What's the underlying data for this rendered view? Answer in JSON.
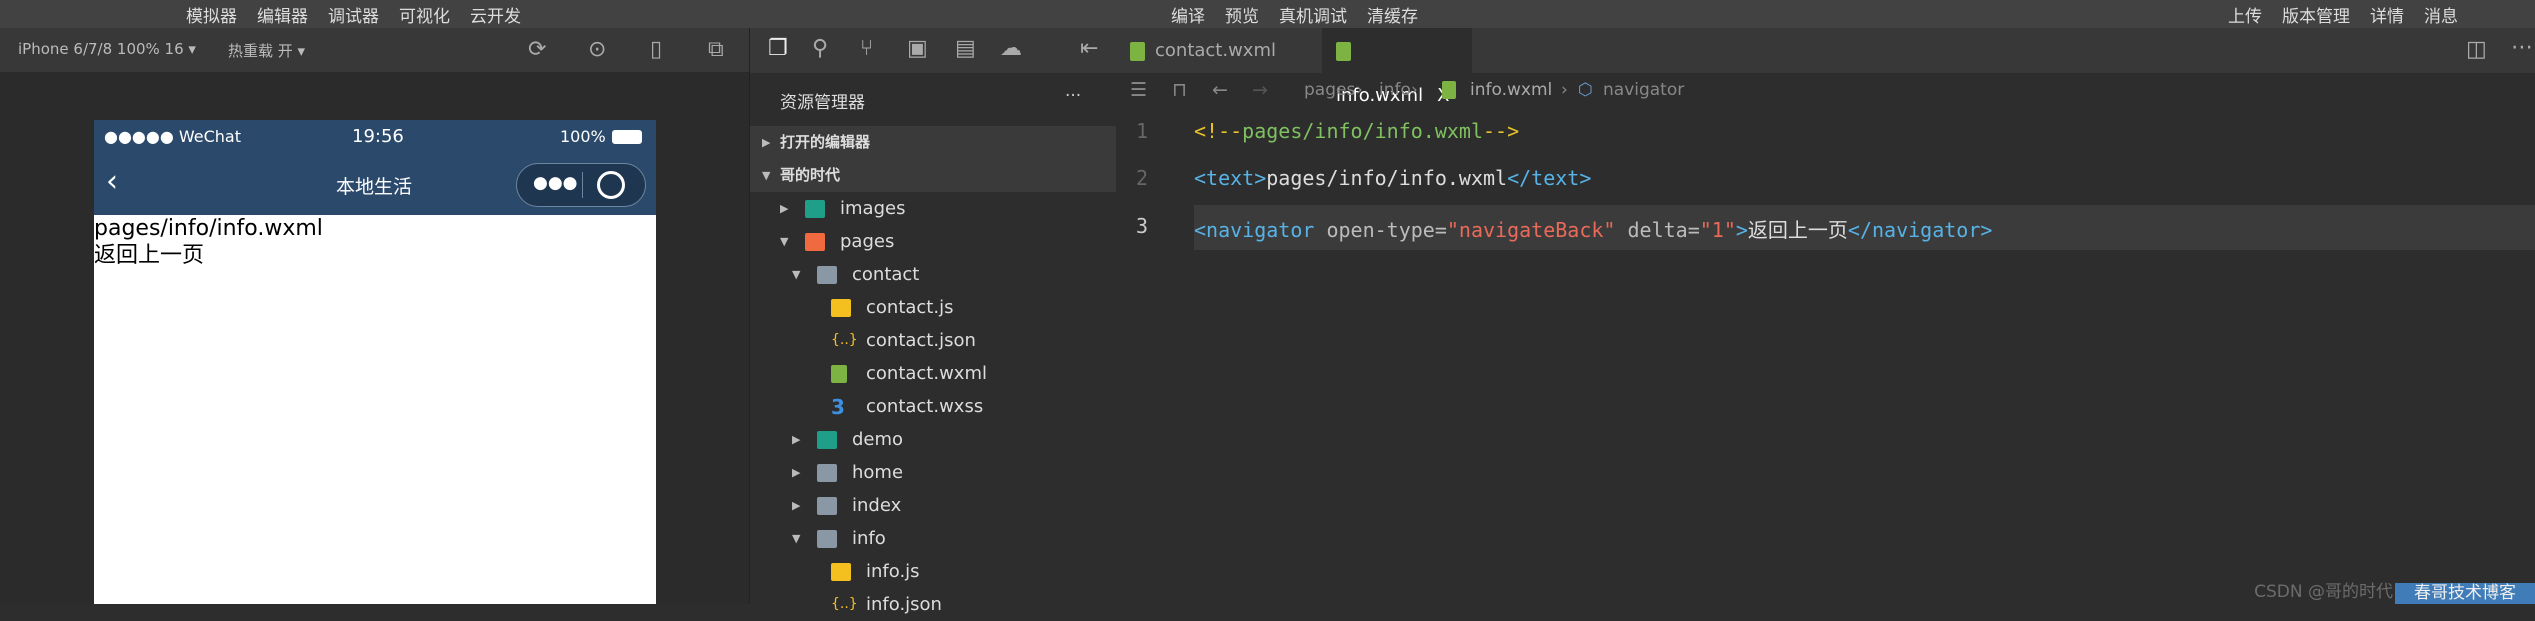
{
  "menubar": {
    "left": [
      "模拟器",
      "编辑器",
      "调试器",
      "可视化",
      "云开发"
    ],
    "center": [
      "编译",
      "预览",
      "真机调试",
      "清缓存"
    ],
    "right": [
      "上传",
      "版本管理",
      "详情",
      "消息"
    ]
  },
  "simulator": {
    "device": "iPhone 6/7/8 100% 16 ▾",
    "hot_reload": "热重载 开 ▾",
    "status": {
      "signal": "●●●●● WeChat",
      "time": "19:56",
      "battery": "100%"
    },
    "nav_title": "本地生活",
    "content": [
      "pages/info/info.wxml",
      "返回上一页"
    ]
  },
  "explorer": {
    "title": "资源管理器",
    "more": "···",
    "sections": [
      "打开的编辑器",
      "哥的时代"
    ],
    "tree": [
      {
        "label": "images",
        "icon": "folder-images",
        "depth": 0,
        "open": false
      },
      {
        "label": "pages",
        "icon": "folder-pages",
        "depth": 0,
        "open": true
      },
      {
        "label": "contact",
        "icon": "folder-open",
        "depth": 1,
        "open": true
      },
      {
        "label": "contact.js",
        "icon": "js",
        "depth": 2
      },
      {
        "label": "contact.json",
        "icon": "json",
        "depth": 2
      },
      {
        "label": "contact.wxml",
        "icon": "wxml",
        "depth": 2
      },
      {
        "label": "contact.wxss",
        "icon": "wxss",
        "depth": 2
      },
      {
        "label": "demo",
        "icon": "folder-images",
        "depth": 1,
        "open": false
      },
      {
        "label": "home",
        "icon": "folder",
        "depth": 1,
        "open": false
      },
      {
        "label": "index",
        "icon": "folder",
        "depth": 1,
        "open": false
      },
      {
        "label": "info",
        "icon": "folder-open",
        "depth": 1,
        "open": true
      },
      {
        "label": "info.js",
        "icon": "js",
        "depth": 2
      },
      {
        "label": "info.json",
        "icon": "json",
        "depth": 2
      }
    ]
  },
  "editor": {
    "tabs": [
      {
        "label": "contact.wxml",
        "active": false
      },
      {
        "label": "info.wxml",
        "active": true
      }
    ],
    "close": "X",
    "breadcrumb": [
      "pages",
      "info",
      "info.wxml",
      "navigator"
    ],
    "lines": [
      [
        [
          "cmb",
          "<!--"
        ],
        [
          "cm",
          "pages/info/info.wxml"
        ],
        [
          "cmb",
          "-->"
        ]
      ],
      [
        [
          "tag",
          "<text>"
        ],
        [
          "tx",
          "pages/info/info.wxml"
        ],
        [
          "tag",
          "</text>"
        ]
      ],
      [
        [
          "tag",
          "<navigator"
        ],
        [
          "at",
          " open-type="
        ],
        [
          "str",
          "\"navigateBack\""
        ],
        [
          "at",
          " delta="
        ],
        [
          "str",
          "\"1\""
        ],
        [
          "tag",
          ">"
        ],
        [
          "tx",
          "返回上一页"
        ],
        [
          "tag",
          "</navigator>"
        ]
      ]
    ]
  },
  "watermark": {
    "text": "春哥技术博客",
    "behind": "CSDN @哥的时代"
  }
}
